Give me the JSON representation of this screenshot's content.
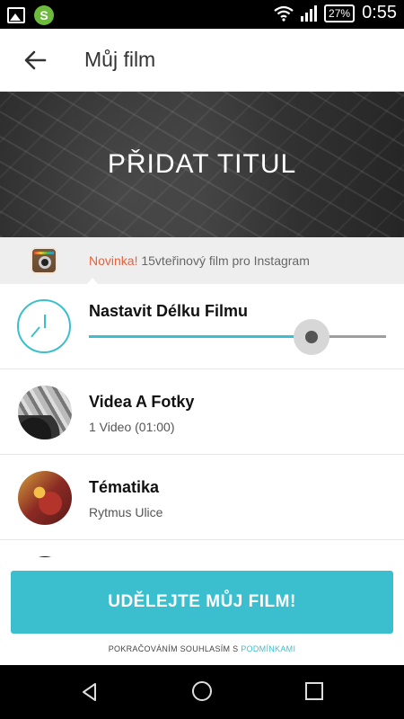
{
  "status_bar": {
    "icons": [
      "image-icon",
      "s-app-icon",
      "wifi-icon",
      "signal-icon"
    ],
    "s_icon_label": "S",
    "battery": "27%",
    "time": "0:55"
  },
  "app_bar": {
    "back_icon": "arrow-left-icon",
    "title": "Můj film"
  },
  "hero": {
    "title": "PŘIDAT TITUL"
  },
  "instagram_banner": {
    "icon": "instagram-icon",
    "highlight": "Novinka!",
    "text": " 15vteřinový film pro Instagram",
    "highlight_color": "#e9603a"
  },
  "rows": {
    "length": {
      "icon": "clock-icon",
      "title": "Nastavit Délku Filmu",
      "slider_value": 0.75
    },
    "media": {
      "title": "Videa A Fotky",
      "subtitle": "1 Video (01:00)"
    },
    "theme": {
      "title": "Tématika",
      "subtitle": "Rytmus Ulice"
    }
  },
  "cta": {
    "label": "UDĚLEJTE MŮJ FILM!",
    "terms_prefix": "POKRAČOVÁNÍM SOUHLASÍM S ",
    "terms_link": "PODMÍNKAMI",
    "accent": "#3bbfcf"
  },
  "nav_bar": {
    "icons": [
      "nav-back-icon",
      "nav-home-icon",
      "nav-recent-icon"
    ]
  }
}
